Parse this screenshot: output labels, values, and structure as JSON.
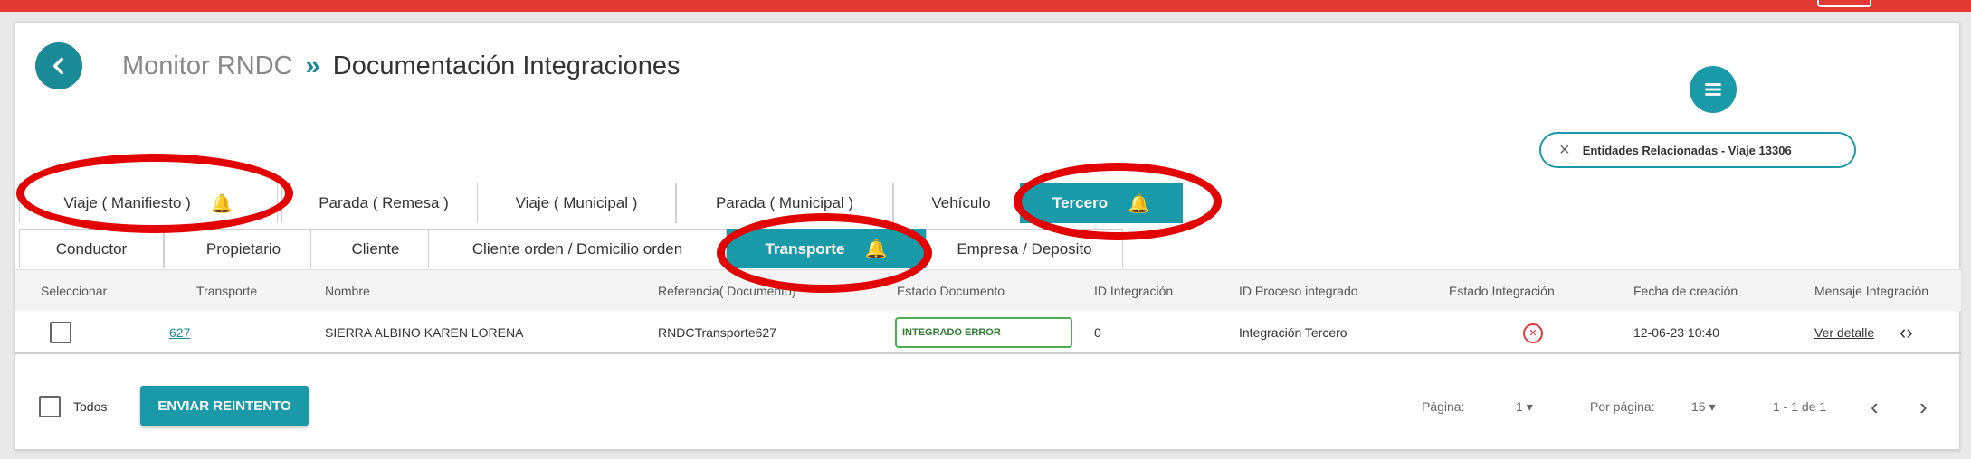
{
  "breadcrumb": {
    "parent": "Monitor RNDC",
    "separator": "»",
    "current": "Documentación Integraciones"
  },
  "chip": {
    "close": "×",
    "label": "Entidades Relacionadas - Viaje 13306"
  },
  "tabs_level1": [
    {
      "label": "Viaje ( Manifiesto )",
      "bell": true,
      "active": false
    },
    {
      "label": "Parada ( Remesa )",
      "bell": false,
      "active": false
    },
    {
      "label": "Viaje ( Municipal )",
      "bell": false,
      "active": false
    },
    {
      "label": "Parada ( Municipal )",
      "bell": false,
      "active": false
    },
    {
      "label": "Vehículo",
      "bell": false,
      "active": false
    },
    {
      "label": "Tercero",
      "bell": true,
      "active": true
    }
  ],
  "tabs_level2": [
    {
      "label": "Conductor",
      "active": false
    },
    {
      "label": "Propietario",
      "active": false
    },
    {
      "label": "Cliente",
      "active": false
    },
    {
      "label": "Cliente orden / Domicilio orden",
      "active": false
    },
    {
      "label": "Transporte",
      "active": true,
      "bell": true
    },
    {
      "label": "Empresa / Deposito",
      "active": false
    }
  ],
  "table": {
    "headers": [
      "Seleccionar",
      "Transporte",
      "Nombre",
      "Referencia( Documento)",
      "Estado Documento",
      "ID Integración",
      "ID Proceso integrado",
      "Estado Integración",
      "Fecha de creación",
      "Mensaje Integración"
    ],
    "row": {
      "transporte": "627",
      "nombre": "SIERRA ALBINO KAREN LORENA",
      "referencia": "RNDCTransporte627",
      "estado_documento": "INTEGRADO ERROR",
      "id_integracion": "0",
      "id_proceso": "Integración Tercero",
      "fecha": "12-06-23 10:40",
      "mensaje": "Ver detalle"
    }
  },
  "footer": {
    "todos": "Todos",
    "send_button": "ENVIAR REINTENTO",
    "pagina_label": "Página:",
    "pagina_value": "1",
    "por_pagina_label": "Por página:",
    "por_pagina_value": "15",
    "range": "1 - 1 de 1"
  },
  "colors": {
    "accent": "#1a9aa8",
    "topbar": "#e53935",
    "annotation": "#e20000",
    "bell": "#f0b400"
  }
}
